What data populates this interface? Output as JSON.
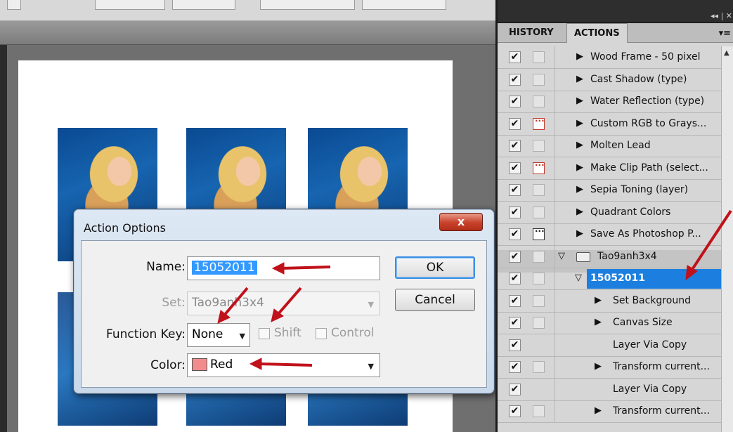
{
  "panel": {
    "tabs": [
      {
        "label": "HISTORY"
      },
      {
        "label": "ACTIONS"
      }
    ],
    "top_controls": "◂◂ | ✕",
    "menu_icon": "▾≡",
    "rows": [
      {
        "label": "Wood Frame - 50 pixel",
        "checked": true,
        "dialog": "none",
        "expand": "collapsed"
      },
      {
        "label": "Cast Shadow (type)",
        "checked": true,
        "dialog": "none",
        "expand": "collapsed"
      },
      {
        "label": "Water Reflection (type)",
        "checked": true,
        "dialog": "none",
        "expand": "collapsed"
      },
      {
        "label": "Custom RGB to Grays...",
        "checked": true,
        "dialog": "red",
        "expand": "collapsed"
      },
      {
        "label": "Molten Lead",
        "checked": true,
        "dialog": "none",
        "expand": "collapsed"
      },
      {
        "label": "Make Clip Path (select...",
        "checked": true,
        "dialog": "red",
        "expand": "collapsed"
      },
      {
        "label": "Sepia Toning (layer)",
        "checked": true,
        "dialog": "none",
        "expand": "collapsed"
      },
      {
        "label": "Quadrant Colors",
        "checked": true,
        "dialog": "none",
        "expand": "collapsed"
      },
      {
        "label": "Save As Photoshop P...",
        "checked": true,
        "dialog": "dark",
        "expand": "collapsed"
      },
      {
        "label": "Tao9anh3x4",
        "checked": true,
        "dialog": "none",
        "expand": "expanded",
        "kind": "set"
      },
      {
        "label": "15052011",
        "checked": true,
        "dialog": "none",
        "expand": "expanded",
        "kind": "action",
        "selected": true
      },
      {
        "label": "Set Background",
        "checked": true,
        "dialog": "none",
        "expand": "collapsed",
        "kind": "step"
      },
      {
        "label": "Canvas Size",
        "checked": true,
        "dialog": "none",
        "expand": "collapsed",
        "kind": "step"
      },
      {
        "label": "Layer Via Copy",
        "checked": true,
        "dialog": "hidden",
        "expand": "none",
        "kind": "step"
      },
      {
        "label": "Transform current...",
        "checked": true,
        "dialog": "none",
        "expand": "collapsed",
        "kind": "step"
      },
      {
        "label": "Layer Via Copy",
        "checked": true,
        "dialog": "hidden",
        "expand": "none",
        "kind": "step"
      },
      {
        "label": "Transform current...",
        "checked": true,
        "dialog": "none",
        "expand": "collapsed",
        "kind": "step"
      }
    ]
  },
  "dialog": {
    "title": "Action Options",
    "close_label": "x",
    "name_label": "Name:",
    "name_value": "15052011",
    "set_label": "Set:",
    "set_value": "Tao9anh3x4",
    "function_key_label": "Function Key:",
    "function_key_value": "None",
    "shift_label": "Shift",
    "control_label": "Control",
    "color_label": "Color:",
    "color_value": "Red",
    "color_swatch": "#f28b8b",
    "ok_label": "OK",
    "cancel_label": "Cancel"
  },
  "colors": {
    "arrow": "#c0121b",
    "selection": "#1c7fe0"
  }
}
